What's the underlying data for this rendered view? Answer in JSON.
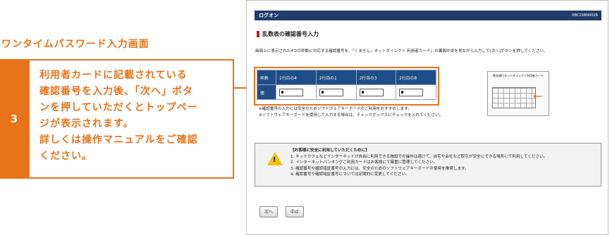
{
  "guide": {
    "title": "ワンタイムパスワード入力画面",
    "step_number": "3",
    "step_lines": [
      "利用者カードに記載されている",
      "確認番号を入力後、「次へ」ボタ",
      "ンを押していただくとトップペー",
      "ジが表示されます。",
      "詳しくは操作マニュアルをご確認",
      "ください。"
    ]
  },
  "screen": {
    "titlebar": {
      "title": "ログオン",
      "id": "KBC15BN002B"
    },
    "section_heading": "乱数表の確認番号入力",
    "description": "画面上に表示された4つの枠数に対応する確認番号を、『くまぎん』ネットダイレクト 利用者カード』の裏面中央を見ながら入力して[次へ]ボタンを押してください。",
    "table": {
      "header": [
        "枠数",
        "1行目の4",
        "2行目の1",
        "2行目の3",
        "2行目の8"
      ],
      "value_label": "値"
    },
    "card_title": "熊本銀行ネットダイレクト利用者カード",
    "notes": [
      "※確認番号の入力には安全のためソフトウェアキーボードのご利用をおすすめします。",
      "※ソフトウェアキーボードを使用して入力する場合は、チェックボックスにチェックを入れてください。"
    ],
    "warning": {
      "heading": "【お客様に安全に利用していただくために】",
      "lines": [
        "1. ネットカフェなどインターネットが自由に利用できる施設での操作は避けて、自宅や会社など取引が安全にできる場所にて利用してください。",
        "2. インターネットバンキングご利用カードはお客様にて厳重に管理してください。",
        "3. 確認番号や確認暗証番号の入力には、安全のためのソフトウェアキーボードの使用を推奨します。",
        "4. 確認番号や確認暗証番号については定期的に変更してください。"
      ]
    },
    "buttons": {
      "next": "次へ",
      "stop": "中止"
    }
  },
  "colors": {
    "accent": "#e8731a",
    "navy": "#1f4e86",
    "titlebar": "#1f3c6b"
  }
}
